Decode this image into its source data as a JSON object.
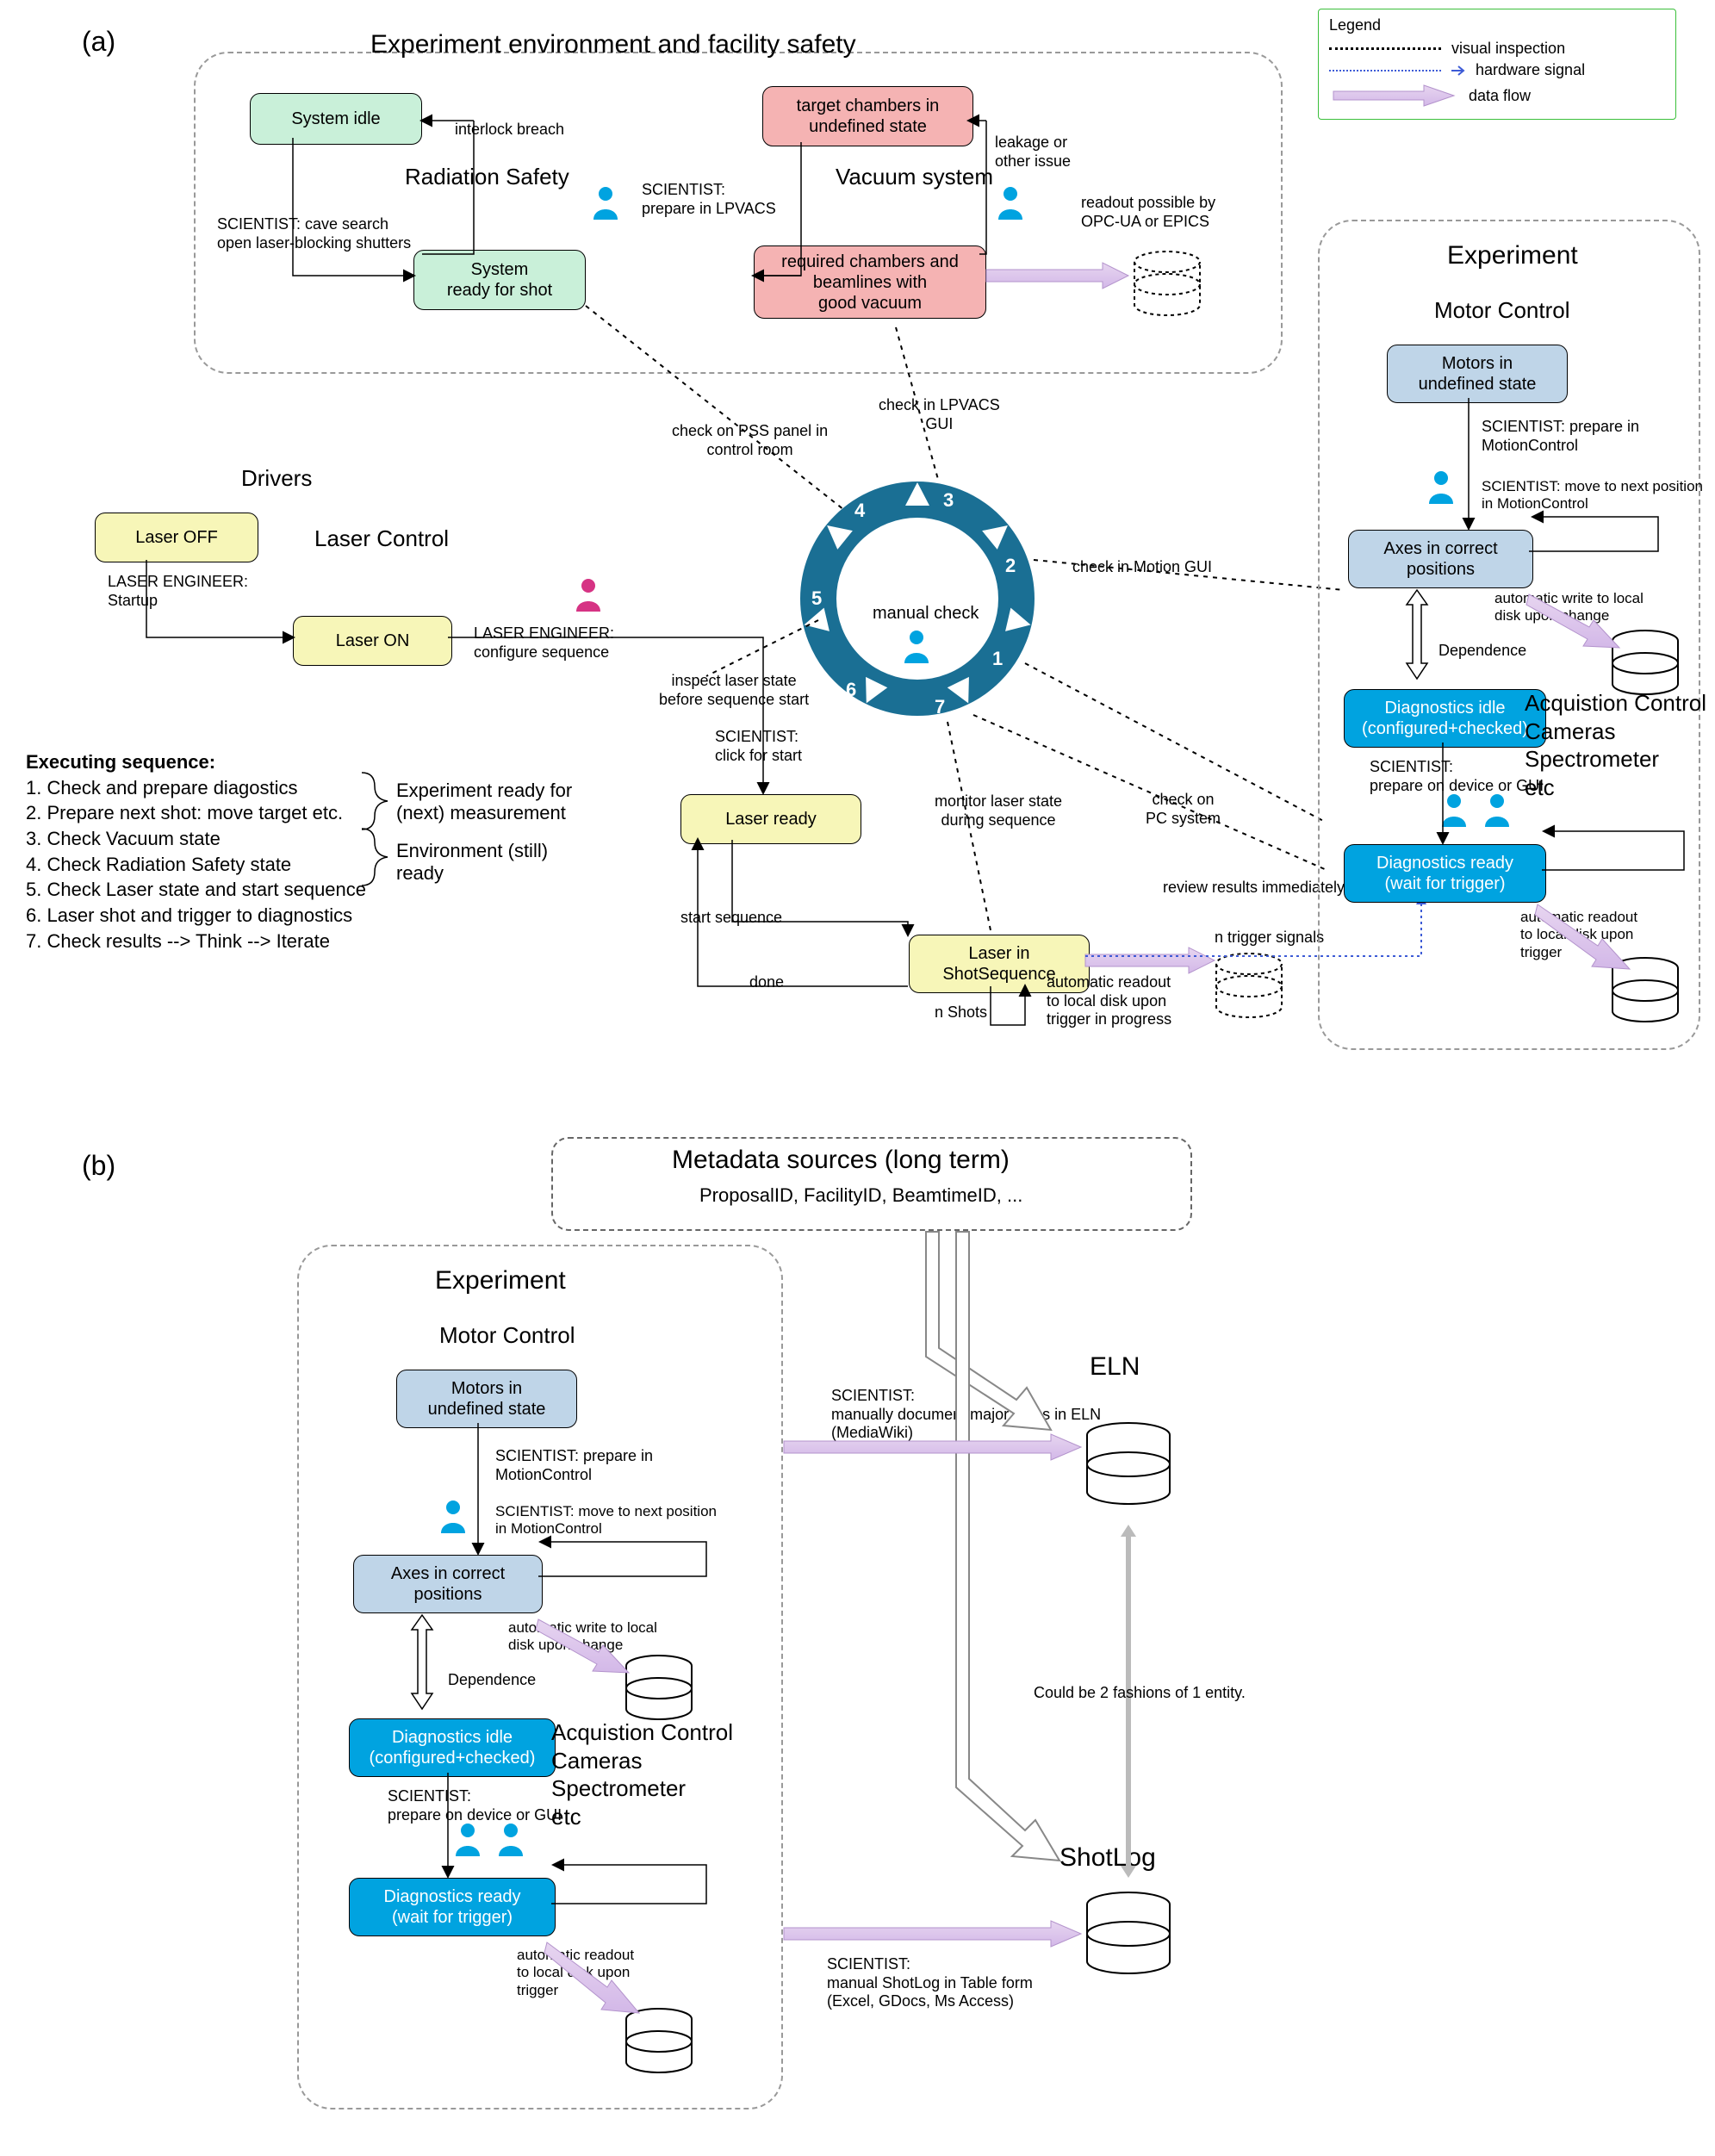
{
  "panels": {
    "a": "(a)",
    "b": "(b)"
  },
  "legend": {
    "title": "Legend",
    "visual": "visual inspection",
    "hardware": "hardware signal",
    "dataflow": "data flow"
  },
  "boxes": {
    "env_safety": "Experiment environment and facility safety",
    "experiment": "Experiment",
    "drivers": "Drivers",
    "laser_control": "Laser Control",
    "radiation_safety": "Radiation Safety",
    "vacuum_system": "Vacuum system",
    "motor_control": "Motor Control",
    "acq_control": "Acquistion Control\nCameras\nSpectrometer\netc",
    "metadata_sources": "Metadata sources (long term)",
    "metadata_sources_sub": "ProposalID, FacilityID, BeamtimeID, ..."
  },
  "nodes": {
    "system_idle": "System idle",
    "system_ready": "System\nready for shot",
    "target_undef": "target chambers in\nundefined state",
    "vacuum_good": "required chambers and\nbeamlines with\ngood vacuum",
    "laser_off": "Laser OFF",
    "laser_on": "Laser ON",
    "laser_ready": "Laser ready",
    "laser_shotseq": "Laser in\nShotSequence",
    "motors_undef": "Motors in\nundefined state",
    "axes_correct": "Axes in correct\npositions",
    "diag_idle": "Diagnostics idle\n(configured+checked)",
    "diag_ready": "Diagnostics ready\n(wait for trigger)"
  },
  "edge": {
    "interlock": "interlock breach",
    "cave_search": "SCIENTIST: cave search\nopen laser-blocking shutters",
    "leakage": "leakage or\nother issue",
    "prep_lpvacs": "SCIENTIST:\nprepare in LPVACS",
    "readout_opcua": "readout possible by\nOPC-UA or EPICS",
    "startup": "LASER ENGINEER:\nStartup",
    "configure": "LASER ENGINEER:\nconfigure sequence",
    "inspect_laser": "inspect laser state\nbefore sequence start",
    "click_start": "SCIENTIST:\nclick for start",
    "start_seq": "start sequence",
    "done": "done",
    "nshots": "n Shots",
    "auto_readout_prog": "automatic readout\nto local disk upon\ntrigger in progress",
    "ntrigger": "n trigger signals",
    "monitor_laser": "monitor laser state\nduring sequence",
    "pss_panel": "check on PSS panel in\ncontrol room",
    "lpvacs_gui": "check in LPVACS\nGUI",
    "motion_gui": "check in Motion GUI",
    "check_pc": "check on\nPC system",
    "review": "review results immediately",
    "prep_motion": "SCIENTIST: prepare in\nMotionControl",
    "move_next": "SCIENTIST: move to next position\nin MotionControl",
    "auto_write": "automatic write to local\ndisk upon change",
    "dependence": "Dependence",
    "prep_device": "SCIENTIST:\nprepare on device or GUI",
    "auto_readout_trig": "automatic readout\nto local disk upon\ntrigger",
    "manual_check": "manual check",
    "eln": "ELN",
    "eln_note": "SCIENTIST:\nmanually document major steps in ELN\n(MediaWiki)",
    "shotlog": "ShotLog",
    "shotlog_note": "SCIENTIST:\nmanual ShotLog in Table form\n(Excel, GDocs, Ms Access)",
    "two_fashions": "Could be 2 fashions of 1 entity."
  },
  "seq": {
    "title": "Executing sequence:",
    "s1": "1. Check and prepare diagostics",
    "s2": "2. Prepare next shot: move target etc.",
    "s3": "3. Check Vacuum state",
    "s4": "4. Check Radiation Safety state",
    "s5": "5. Check Laser state and start sequence",
    "s6": "6. Laser shot and trigger to diagnostics",
    "s7": "7. Check results --> Think --> Iterate",
    "b1": "Experiment ready for\n(next) measurement",
    "b2": "Environment (still)\nready"
  },
  "ring": {
    "n1": "1",
    "n2": "2",
    "n3": "3",
    "n4": "4",
    "n5": "5",
    "n6": "6",
    "n7": "7"
  }
}
